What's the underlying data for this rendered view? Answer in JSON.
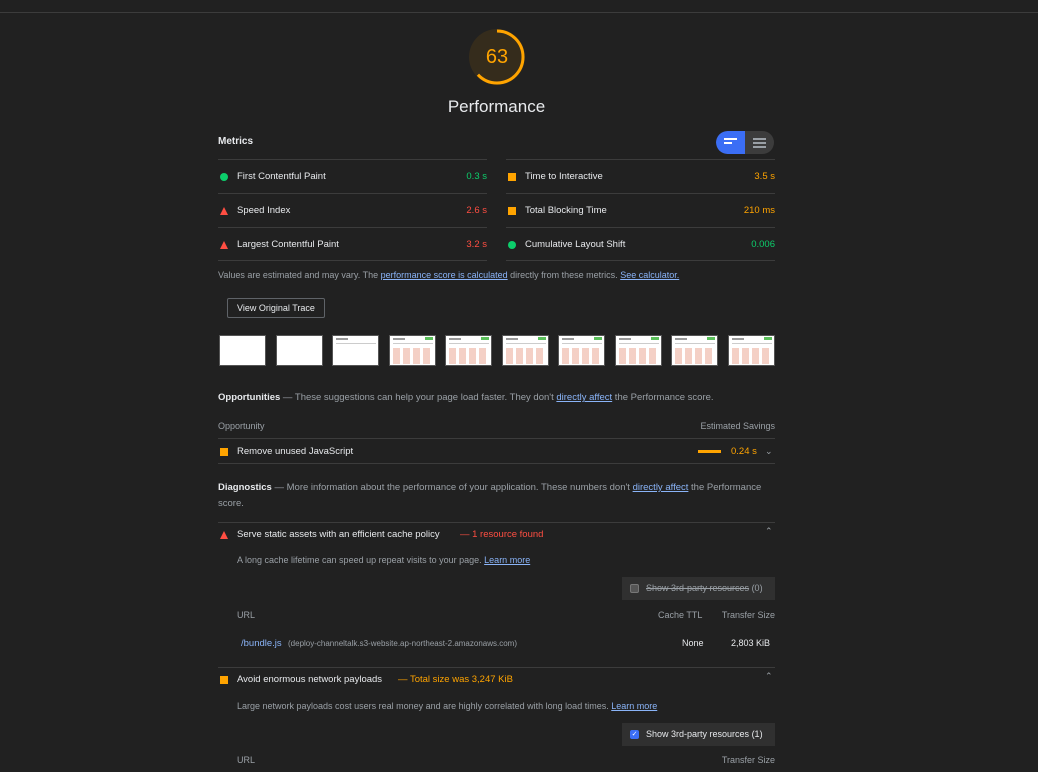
{
  "score": {
    "value": "63",
    "fraction": 0.63,
    "title": "Performance",
    "color": "#ffa400"
  },
  "metrics": {
    "title": "Metrics",
    "left": [
      {
        "label": "First Contentful Paint",
        "value": "0.3 s",
        "status": "pass"
      },
      {
        "label": "Speed Index",
        "value": "2.6 s",
        "status": "fail"
      },
      {
        "label": "Largest Contentful Paint",
        "value": "3.2 s",
        "status": "fail"
      }
    ],
    "right": [
      {
        "label": "Time to Interactive",
        "value": "3.5 s",
        "status": "average"
      },
      {
        "label": "Total Blocking Time",
        "value": "210 ms",
        "status": "average"
      },
      {
        "label": "Cumulative Layout Shift",
        "value": "0.006",
        "status": "pass"
      }
    ],
    "note_pre": "Values are estimated and may vary. The ",
    "note_link1": "performance score is calculated",
    "note_mid": " directly from these metrics. ",
    "note_link2": "See calculator."
  },
  "trace_button": "View Original Trace",
  "filmstrip_count": 10,
  "opportunities": {
    "title": "Opportunities",
    "desc_pre": " — These suggestions can help your page load faster. They don't ",
    "desc_link": "directly affect",
    "desc_post": " the Performance score.",
    "col_left": "Opportunity",
    "col_right": "Estimated Savings",
    "items": [
      {
        "label": "Remove unused JavaScript",
        "savings": "0.24 s"
      }
    ]
  },
  "diagnostics": {
    "title": "Diagnostics",
    "desc_pre": " — More information about the performance of your application. These numbers don't ",
    "desc_link": "directly affect",
    "desc_post": " the Performance score.",
    "cache": {
      "label": "Serve static assets with an efficient cache policy",
      "display": "— 1 resource found",
      "desc": "A long cache lifetime can speed up repeat visits to your page.",
      "learn": "Learn more",
      "third_party": "Show 3rd-party resources",
      "third_party_count": "(0)",
      "col_url": "URL",
      "col_ttl": "Cache TTL",
      "col_size": "Transfer Size",
      "row": {
        "url": "/bundle.js",
        "host": "(deploy-channeltalk.s3-website.ap-northeast-2.amazonaws.com)",
        "ttl": "None",
        "size": "2,803 KiB"
      }
    },
    "payload": {
      "label": "Avoid enormous network payloads",
      "display": "— Total size was 3,247 KiB",
      "desc": "Large network payloads cost users real money and are highly correlated with long load times.",
      "learn": "Learn more",
      "third_party": "Show 3rd-party resources",
      "third_party_count": "(1)",
      "col_url": "URL",
      "col_size": "Transfer Size"
    }
  }
}
